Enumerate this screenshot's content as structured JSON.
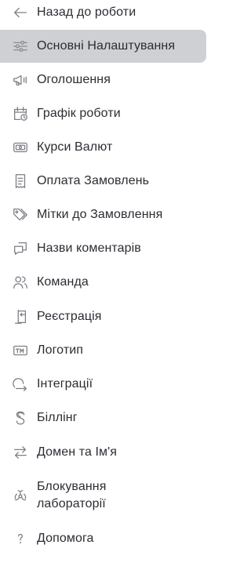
{
  "sidebar": {
    "back": {
      "label": "Назад до роботи",
      "icon": "arrow-left-icon"
    },
    "items": [
      {
        "label": "Основні Налаштування",
        "icon": "sliders-icon",
        "active": true
      },
      {
        "label": "Оголошення",
        "icon": "megaphone-icon"
      },
      {
        "label": "Графік роботи",
        "icon": "calendar-clock-icon"
      },
      {
        "label": "Курси Валют",
        "icon": "currency-icon"
      },
      {
        "label": "Оплата Замовлень",
        "icon": "receipt-icon"
      },
      {
        "label": "Мітки до Замовлення",
        "icon": "tags-icon"
      },
      {
        "label": "Назви коментарів",
        "icon": "comment-icon"
      },
      {
        "label": "Команда",
        "icon": "users-icon"
      },
      {
        "label": "Реєстрація",
        "icon": "sign-in-icon"
      },
      {
        "label": "Логотип",
        "icon": "trademark-icon"
      },
      {
        "label": "Інтеграції",
        "icon": "integration-icon"
      },
      {
        "label": "Біллінг",
        "icon": "billing-icon"
      },
      {
        "label": "Домен та Ім'я",
        "icon": "swap-icon"
      },
      {
        "label": "Блокування\nлабораторії",
        "icon": "biohazard-icon"
      },
      {
        "label": "Допомога",
        "icon": "help-icon"
      }
    ]
  },
  "colors": {
    "active_background": "#cfd0d3",
    "icon": "#7d7f86",
    "text": "#2b2d33"
  }
}
